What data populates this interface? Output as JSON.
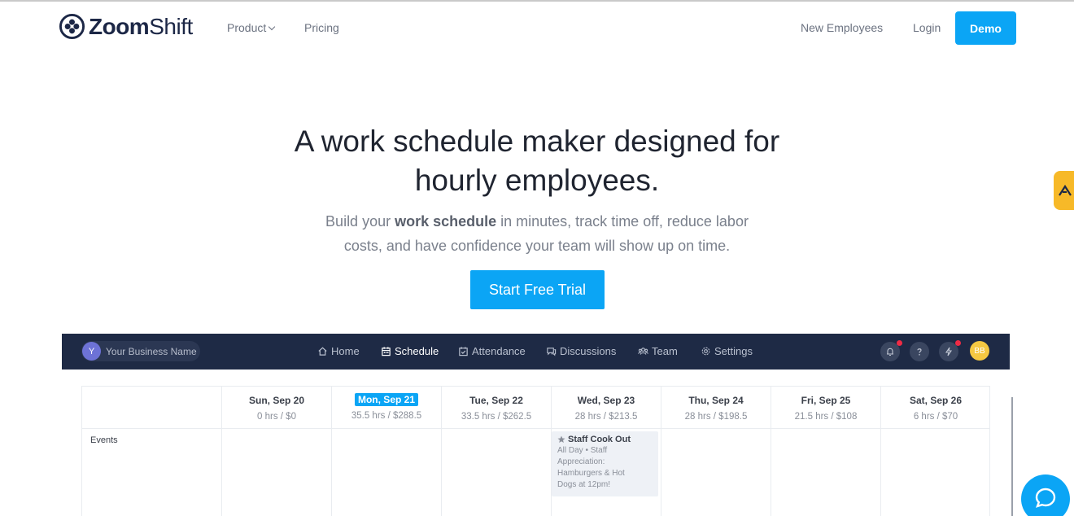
{
  "nav": {
    "logo_bold": "Zoom",
    "logo_light": "Shift",
    "product": "Product",
    "pricing": "Pricing",
    "new_employees": "New Employees",
    "login": "Login",
    "demo": "Demo"
  },
  "hero": {
    "title_line1": "A work schedule maker designed for",
    "title_line2": "hourly employees.",
    "sub_part1": "Build your ",
    "sub_bold": "work schedule",
    "sub_part2": " in minutes, track time off, reduce labor",
    "sub_line2": "costs, and have confidence your team will show up on time.",
    "cta": "Start Free Trial"
  },
  "app": {
    "business_initial": "Y",
    "business_name": "Your Business Name",
    "tabs": [
      {
        "label": "Home",
        "icon": "home-icon"
      },
      {
        "label": "Schedule",
        "icon": "calendar-icon"
      },
      {
        "label": "Attendance",
        "icon": "check-calendar-icon"
      },
      {
        "label": "Discussions",
        "icon": "chat-bubbles-icon"
      },
      {
        "label": "Team",
        "icon": "team-icon"
      },
      {
        "label": "Settings",
        "icon": "gear-icon"
      }
    ],
    "active_tab": "Schedule",
    "user_initials": "BB",
    "days": [
      {
        "day": "Sun, Sep 20",
        "hrs": "0 hrs / $0"
      },
      {
        "day": "Mon, Sep 21",
        "hrs": "35.5 hrs / $288.5",
        "today": true
      },
      {
        "day": "Tue, Sep 22",
        "hrs": "33.5 hrs / $262.5"
      },
      {
        "day": "Wed, Sep 23",
        "hrs": "28 hrs / $213.5"
      },
      {
        "day": "Thu, Sep 24",
        "hrs": "28 hrs / $198.5"
      },
      {
        "day": "Fri, Sep 25",
        "hrs": "21.5 hrs / $108"
      },
      {
        "day": "Sat, Sep 26",
        "hrs": "6 hrs / $70"
      }
    ],
    "events_label": "Events",
    "event": {
      "title": "Staff Cook Out",
      "desc_1": "All Day • Staff",
      "desc_2": "Appreciation:",
      "desc_3": "Hamburgers & Hot",
      "desc_4": "Dogs at 12pm!"
    }
  },
  "colors": {
    "accent": "#0ba5f5",
    "app_bar": "#1e2a45",
    "side_tab": "#f7b928",
    "notification_dot": "#ef2b45"
  }
}
